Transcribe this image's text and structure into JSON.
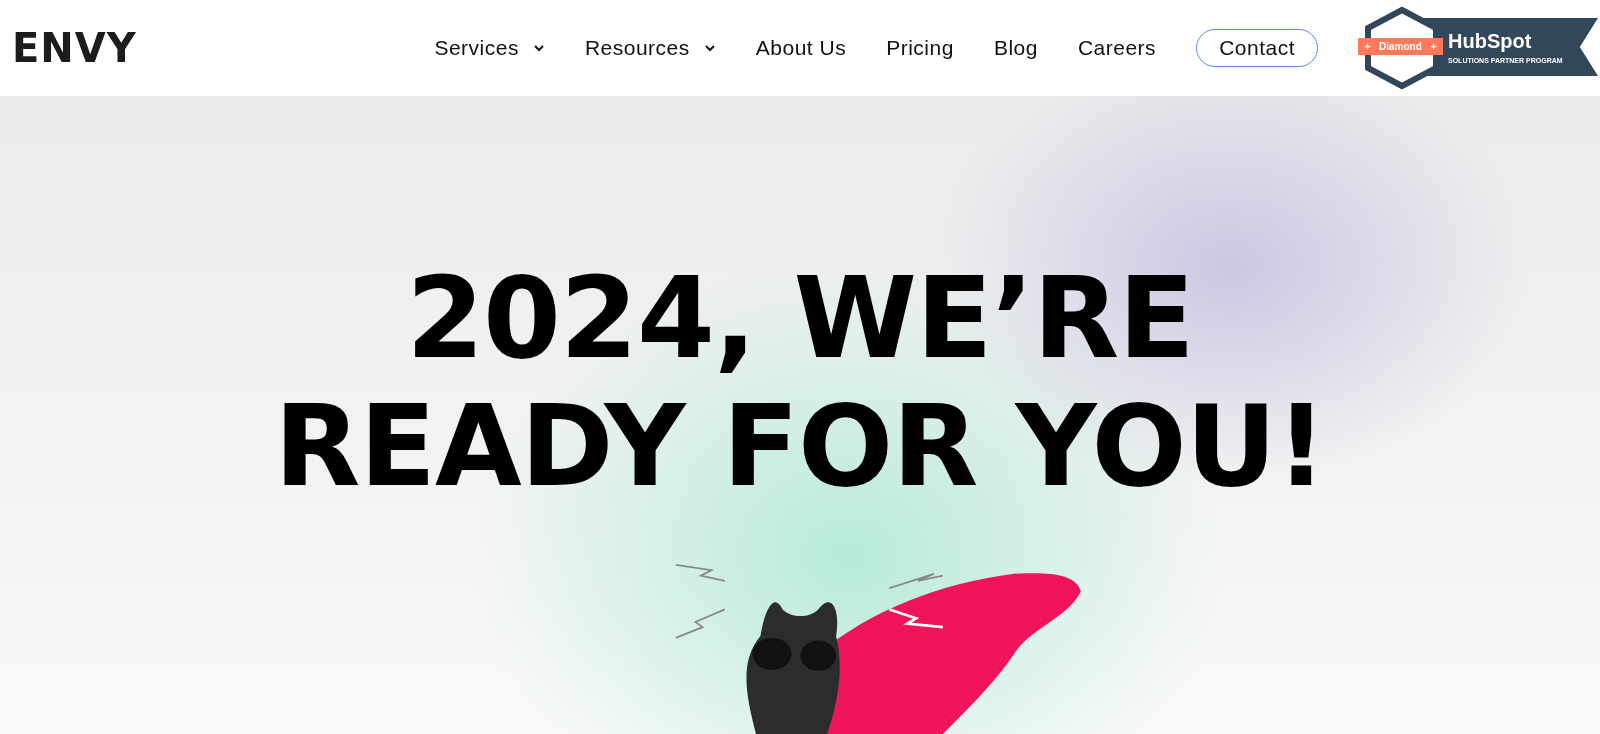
{
  "header": {
    "logo": "ENVY",
    "nav": [
      {
        "label": "Services",
        "kind": "dropdown"
      },
      {
        "label": "Resources",
        "kind": "dropdown"
      },
      {
        "label": "About Us",
        "kind": "link"
      },
      {
        "label": "Pricing",
        "kind": "link"
      },
      {
        "label": "Blog",
        "kind": "link"
      },
      {
        "label": "Careers",
        "kind": "link"
      }
    ],
    "cta": "Contact",
    "badge": {
      "tier": "Diamond",
      "brand": "HubSpot",
      "program": "SOLUTIONS PARTNER PROGRAM"
    }
  },
  "hero": {
    "headline": [
      "2024, WE’RE",
      "READY FOR YOU!"
    ]
  }
}
